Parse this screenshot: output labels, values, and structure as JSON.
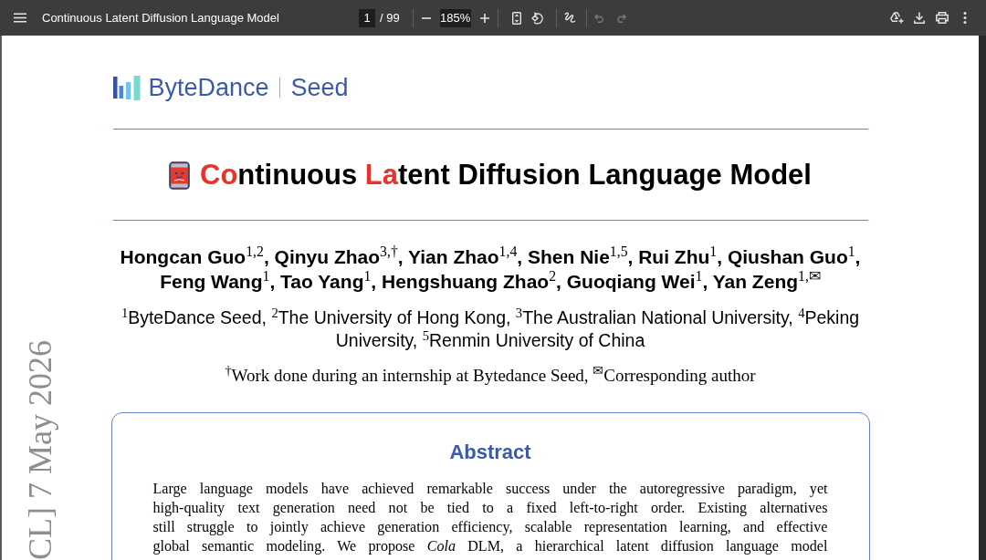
{
  "toolbar": {
    "title": "Continuous Latent Diffusion Language Model",
    "page_input": {
      "value": "1"
    },
    "page_total": "/ 99",
    "zoom_input": {
      "value": "185%"
    },
    "undo": {
      "disabled": true
    },
    "redo": {
      "disabled": true
    }
  },
  "page": {
    "side_stamp": "CL] 7 May 2026",
    "logo": {
      "company": "ByteDance",
      "team": "Seed"
    },
    "title": {
      "segments": [
        {
          "text": "Co",
          "highlight": true
        },
        {
          "text": "ntinuous ",
          "highlight": false
        },
        {
          "text": "La",
          "highlight": true
        },
        {
          "text": "tent Diffusion Language Model",
          "highlight": false
        }
      ]
    },
    "authors": "Hongcan Guo$^{1,2}$, Qinyu Zhao$^{3,†}$, Yian Zhao$^{1,4}$, Shen Nie$^{1,5}$, Rui Zhu$^{1}$, Qiushan Guo$^{1}$, Feng Wang$^{1}$, Tao Yang$^{1}$, Hengshuang Zhao$^{2}$, Guoqiang Wei$^{1}$, Yan Zeng$^{1,✉}$",
    "affiliations": "$^{1}$ByteDance Seed, $^{2}$The University of Hong Kong, $^{3}$The Australian National University, $^{4}$Peking University, $^{5}$Renmin University of China",
    "footnote": "$^{†}$Work done during an internship at Bytedance Seed, $^{✉}$Corresponding author",
    "abstract": {
      "heading": "Abstract",
      "text": "Large language models have achieved remarkable success under the autoregressive paradigm, yet high-quality text generation need not be tied to a fixed left-to-right order. Existing alternatives still struggle to jointly achieve generation efficiency, scalable representation learning, and effective global semantic modeling. We propose *Cola* DLM, a hierarchical latent diffusion language model"
    }
  }
}
